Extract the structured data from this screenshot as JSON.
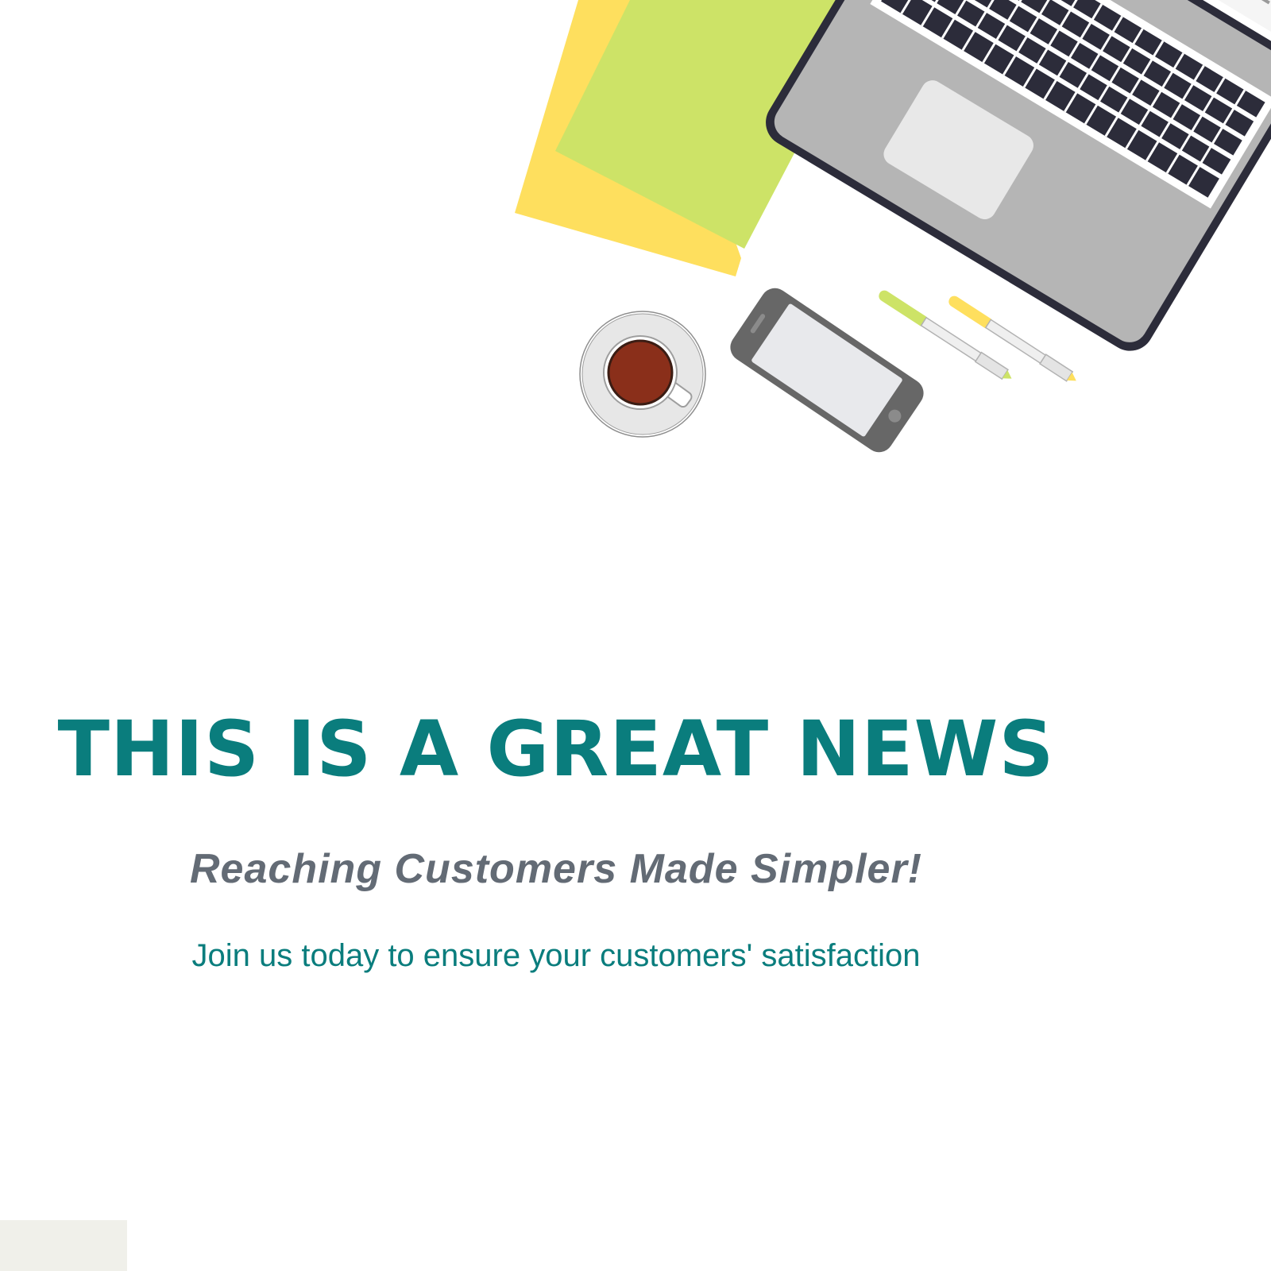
{
  "headline": "THIS IS A GREAT NEWS",
  "subheadline": "Reaching Customers Made Simpler!",
  "body_text": "Join us today to ensure your customers' satisfaction",
  "colors": {
    "teal_accent": "#0a7d7d",
    "subheadline_gray": "#636b75",
    "background": "#ffffff",
    "note_yellow": "#fedf5e",
    "note_green": "#cde367",
    "laptop_gray": "#b5b5b5",
    "dark_outline": "#2c2c3a",
    "coffee": "#8a2f1a",
    "corner_beige": "#f0f0ea"
  },
  "illustration_items": [
    "sticky-notes",
    "laptop",
    "coffee-cup",
    "smartphone",
    "green-pen",
    "yellow-pen"
  ]
}
